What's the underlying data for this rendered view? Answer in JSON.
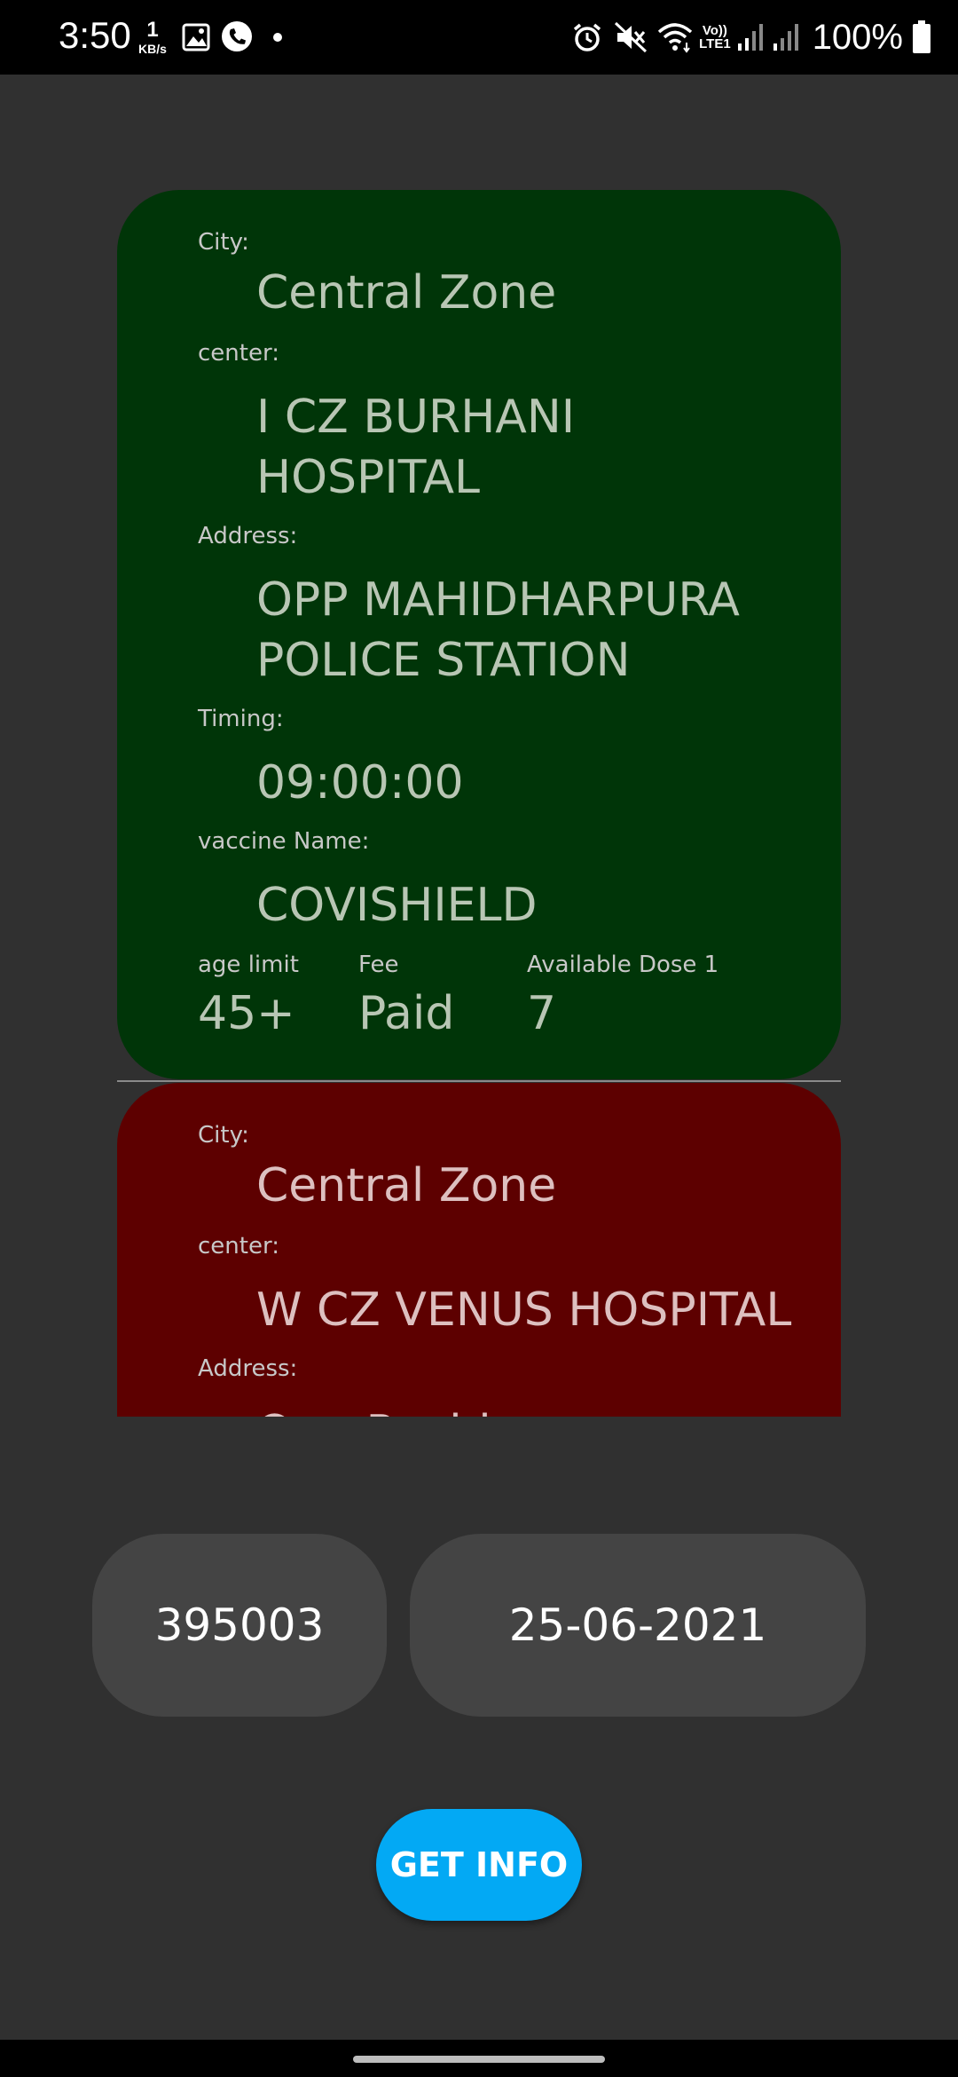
{
  "status_bar": {
    "time": "3:50",
    "net_speed_value": "1",
    "net_speed_unit": "KB/s",
    "volte_top": "Vo))",
    "volte_bottom": "LTE1",
    "battery": "100%",
    "icons": [
      "image-icon",
      "whatsapp-call-icon",
      "dot-icon",
      "alarm-icon",
      "mute-icon",
      "wifi-icon",
      "signal-icon",
      "signal-icon",
      "battery-icon"
    ]
  },
  "centers": [
    {
      "city_label": "City:",
      "city": "Central Zone",
      "center_label": "center:",
      "center_line1": "I CZ BURHANI",
      "center_line2": "HOSPITAL",
      "address_label": "Address:",
      "address_line1": "OPP MAHIDHARPURA",
      "address_line2": "POLICE STATION",
      "timing_label": "Timing:",
      "timing": "09:00:00",
      "vaccine_label": "vaccine Name:",
      "vaccine": "COVISHIELD",
      "age_label": "age limit",
      "age": "45+",
      "fee_label": "Fee",
      "fee": "Paid",
      "dose_label": "Available Dose 1",
      "dose": "7",
      "card_color": "#003508"
    },
    {
      "city_label": "City:",
      "city": "Central Zone",
      "center_label": "center:",
      "center_line1": "W CZ VENUS HOSPITAL",
      "address_label": "Address:",
      "address_partial": "Opp Rushi",
      "card_color": "#5d0000"
    }
  ],
  "form": {
    "pincode": "395003",
    "date": "25-06-2021",
    "button_label": "GET INFO",
    "button_color": "#03a9f4"
  }
}
